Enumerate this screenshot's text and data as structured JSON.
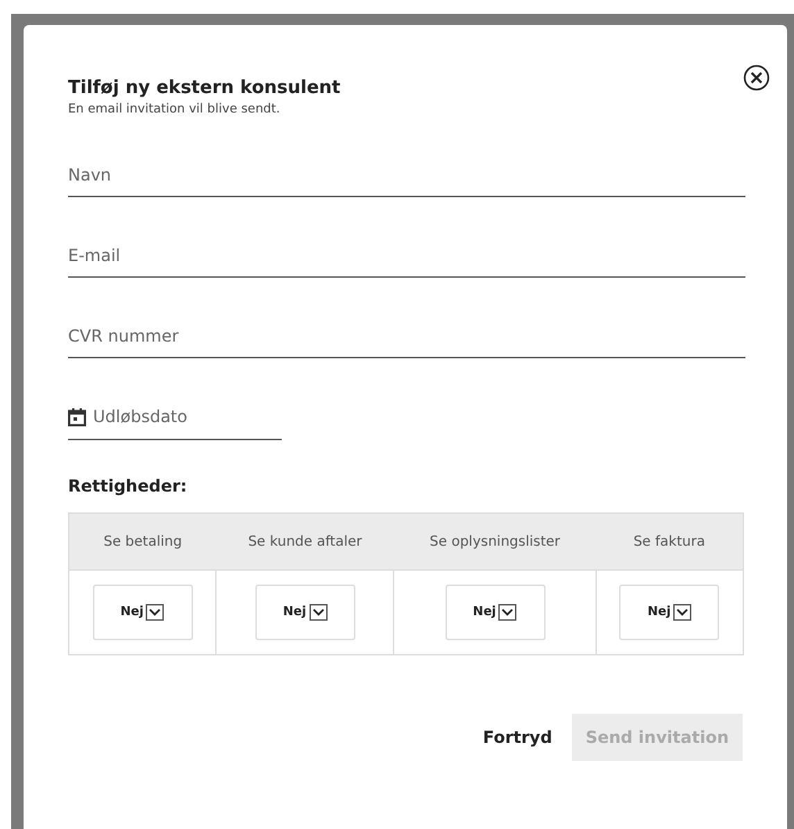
{
  "dialog": {
    "title": "Tilføj ny ekstern konsulent",
    "subtitle": "En email invitation vil blive sendt.",
    "fields": [
      {
        "kind": "text",
        "placeholder": "Navn"
      },
      {
        "kind": "text",
        "placeholder": "E-mail"
      },
      {
        "kind": "text",
        "placeholder": "CVR nummer"
      },
      {
        "kind": "date",
        "placeholder": "Udløbsdato"
      }
    ],
    "permissions_label": "Rettigheder:",
    "permissions": [
      {
        "header": "Se betaling",
        "value": "Nej"
      },
      {
        "header": "Se kunde aftaler",
        "value": "Nej"
      },
      {
        "header": "Se oplysningslister",
        "value": "Nej"
      },
      {
        "header": "Se faktura",
        "value": "Nej"
      }
    ],
    "cancel": "Fortryd",
    "submit": {
      "label": "Send invitation",
      "disabled": true
    }
  }
}
